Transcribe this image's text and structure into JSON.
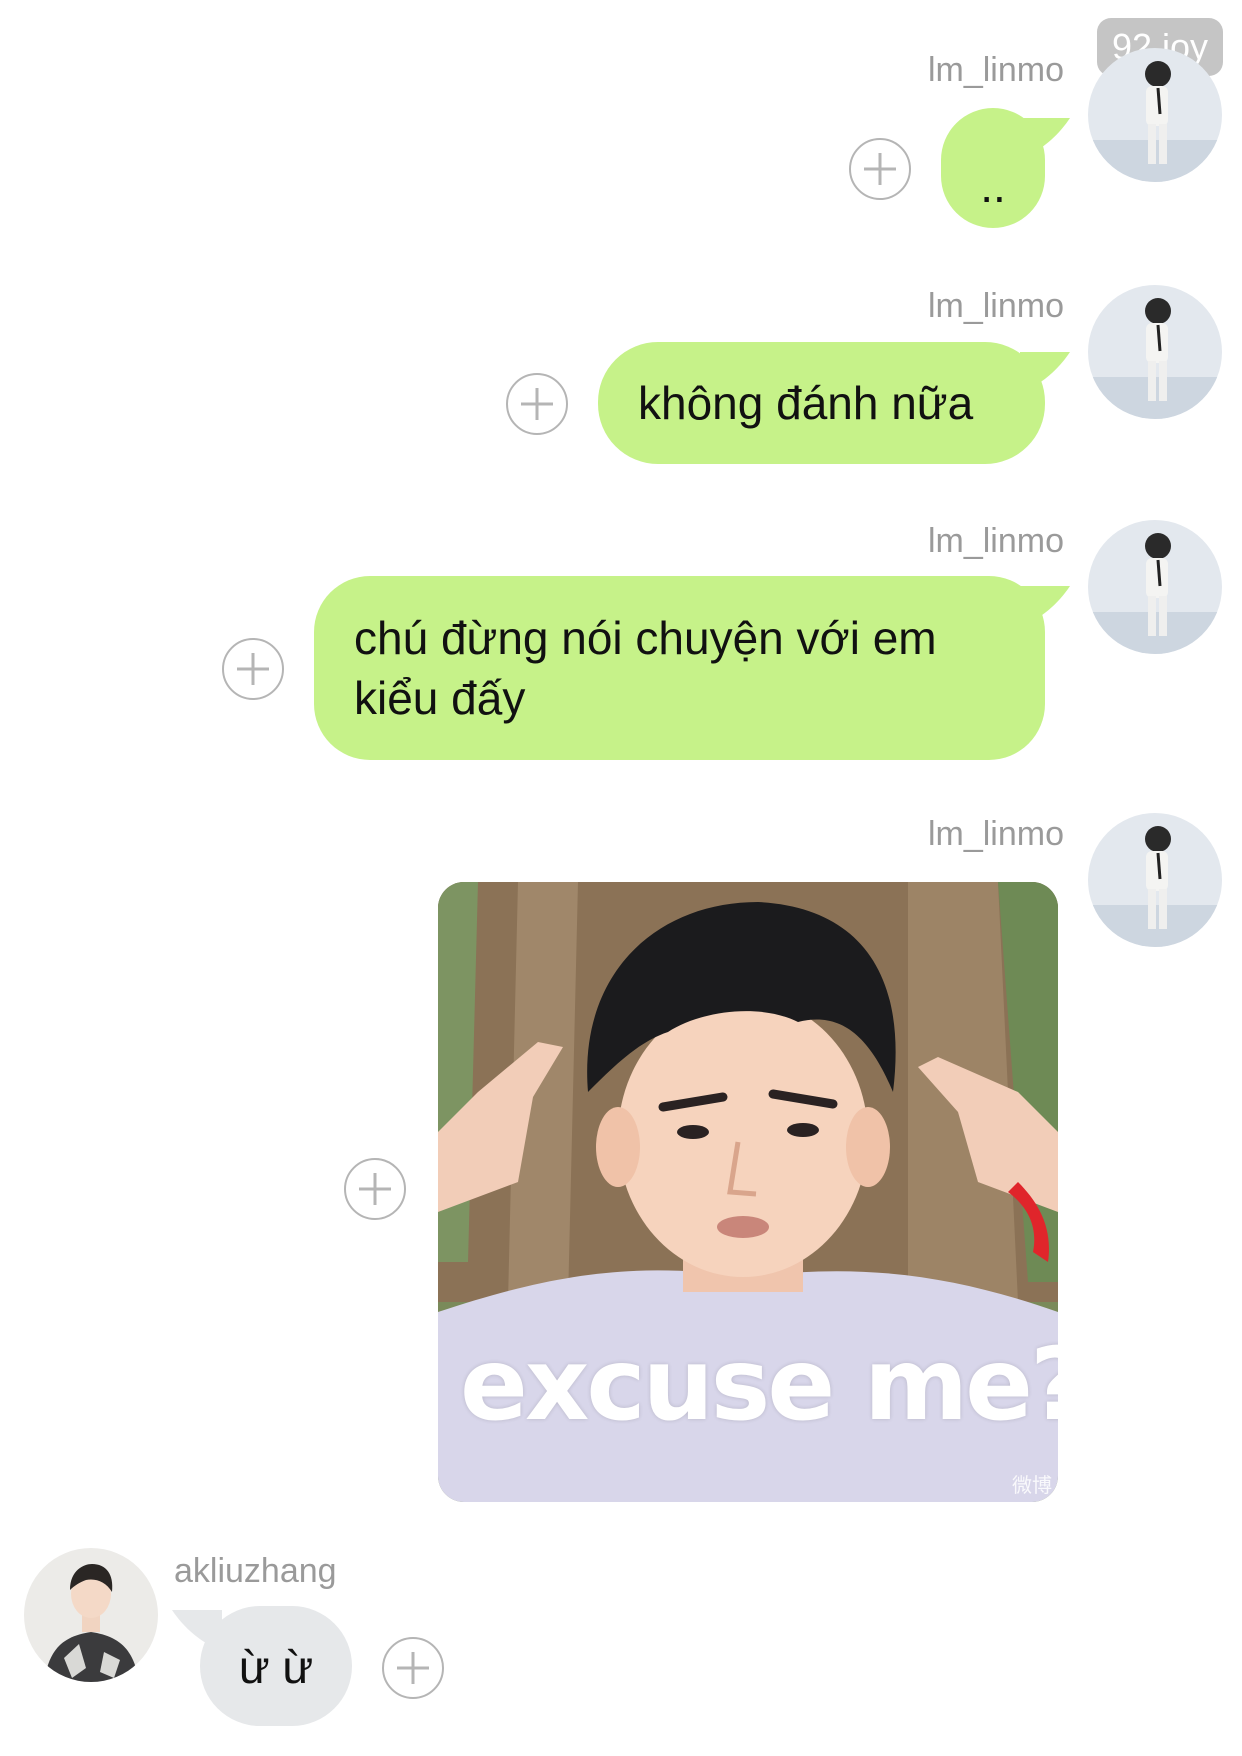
{
  "watermark": "92 joy",
  "messages": [
    {
      "sender": "lm_linmo",
      "text": ".."
    },
    {
      "sender": "lm_linmo",
      "text": "không đánh nữa"
    },
    {
      "sender": "lm_linmo",
      "text_line1": "chú đừng nói chuyện với em",
      "text_line2": "kiểu đấy"
    },
    {
      "sender": "lm_linmo",
      "sticker": {
        "caption": "excuse me?",
        "source_mark": "微博"
      }
    },
    {
      "sender": "akliuzhang",
      "text": "ừ ừ"
    }
  ],
  "colors": {
    "outgoing_bubble": "#c6f289",
    "incoming_bubble": "#e6e8ea",
    "username": "#9a9a9a",
    "add_icon": "#b5b5b5"
  },
  "icons": {
    "add_reaction": "plus-circle-icon",
    "avatar_self": "avatar-photo",
    "avatar_other": "avatar-photo"
  }
}
